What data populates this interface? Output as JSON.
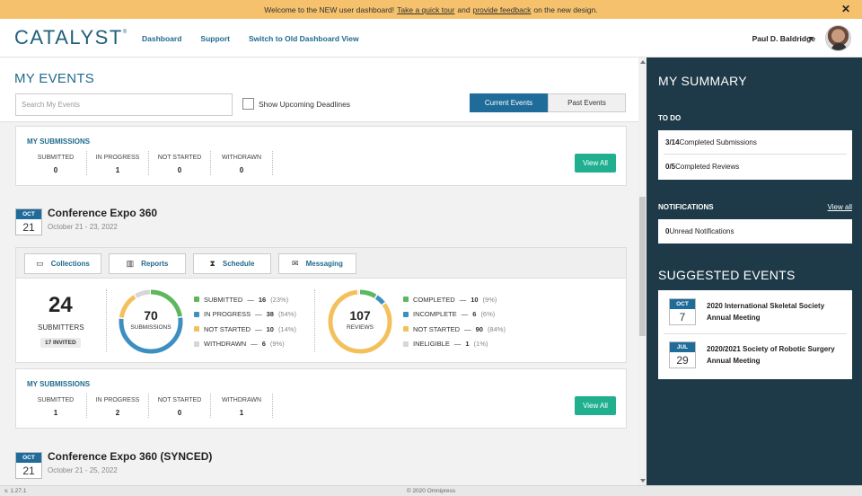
{
  "banner": {
    "text_before": "Welcome to the NEW user dashboard!",
    "link_tour": "Take a quick tour",
    "text_mid": "and",
    "link_feedback": "provide feedback",
    "text_after": "on the new design.",
    "close": "✕"
  },
  "header": {
    "logo": "CATALYST",
    "logo_mark": "®",
    "nav": [
      "Dashboard",
      "Support",
      "Switch to Old Dashboard View"
    ],
    "user_name": "Paul D. Baldridge"
  },
  "main": {
    "title": "MY EVENTS",
    "search_placeholder": "Search My Events",
    "checkbox_label": "Show Upcoming Deadlines",
    "checkbox_checked": false,
    "tabs": [
      "Current Events",
      "Past Events"
    ]
  },
  "top_submissions": {
    "title": "MY SUBMISSIONS",
    "columns": [
      {
        "label": "SUBMITTED",
        "value": "0"
      },
      {
        "label": "IN PROGRESS",
        "value": "1"
      },
      {
        "label": "NOT STARTED",
        "value": "0"
      },
      {
        "label": "WITHDRAWN",
        "value": "0"
      }
    ],
    "view_all": "View All"
  },
  "event1": {
    "month": "OCT",
    "day": "21",
    "name": "Conference Expo 360",
    "dates": "October 21 - 23, 2022",
    "actions": [
      {
        "label": "Collections",
        "icon": "folder-icon",
        "glyph": "▭"
      },
      {
        "label": "Reports",
        "icon": "bar-chart-icon",
        "glyph": "▥"
      },
      {
        "label": "Schedule",
        "icon": "hourglass-icon",
        "glyph": "⧗"
      },
      {
        "label": "Messaging",
        "icon": "envelope-icon",
        "glyph": "✉"
      }
    ],
    "submitters": {
      "count": "24",
      "label": "SUBMITTERS",
      "invited": "17 INVITED"
    },
    "submissions_donut": {
      "total": "70",
      "label": "SUBMISSIONS",
      "segments": [
        {
          "label": "SUBMITTED",
          "count": 16,
          "pct": "(23%)",
          "color": "#5cb85c"
        },
        {
          "label": "IN PROGRESS",
          "count": 38,
          "pct": "(54%)",
          "color": "#3d8fc2"
        },
        {
          "label": "NOT STARTED",
          "count": 10,
          "pct": "(14%)",
          "color": "#f3c05c"
        },
        {
          "label": "WITHDRAWN",
          "count": 6,
          "pct": "(9%)",
          "color": "#d6d6d6"
        }
      ]
    },
    "reviews_donut": {
      "total": "107",
      "label": "REVIEWS",
      "segments": [
        {
          "label": "COMPLETED",
          "count": 10,
          "pct": "(9%)",
          "color": "#5cb85c"
        },
        {
          "label": "INCOMPLETE",
          "count": 6,
          "pct": "(6%)",
          "color": "#3d8fc2"
        },
        {
          "label": "NOT STARTED",
          "count": 90,
          "pct": "(84%)",
          "color": "#f3c05c"
        },
        {
          "label": "INELIGIBLE",
          "count": 1,
          "pct": "(1%)",
          "color": "#d6d6d6"
        }
      ]
    },
    "submissions": {
      "title": "MY SUBMISSIONS",
      "columns": [
        {
          "label": "SUBMITTED",
          "value": "1"
        },
        {
          "label": "IN PROGRESS",
          "value": "2"
        },
        {
          "label": "NOT STARTED",
          "value": "0"
        },
        {
          "label": "WITHDRAWN",
          "value": "1"
        }
      ],
      "view_all": "View All"
    }
  },
  "event2": {
    "month": "OCT",
    "day": "21",
    "name": "Conference Expo 360 (SYNCED)",
    "dates": "October 21 - 25, 2022"
  },
  "sidebar": {
    "title": "MY SUMMARY",
    "todo_title": "TO DO",
    "todo": [
      {
        "strong": "3/14",
        "text": " Completed Submissions"
      },
      {
        "strong": "0/5",
        "text": " Completed Reviews"
      }
    ],
    "notifications_title": "NOTIFICATIONS",
    "notifications_link": "View all",
    "notifications": [
      {
        "strong": "0",
        "text": " Unread Notifications"
      }
    ],
    "suggested_title": "SUGGESTED EVENTS",
    "suggested": [
      {
        "month": "OCT",
        "day": "7",
        "title": "2020 International Skeletal Society Annual Meeting"
      },
      {
        "month": "JUL",
        "day": "29",
        "title": "2020/2021 Society of Robotic Surgery Annual Meeting"
      }
    ]
  },
  "footer": {
    "version": "v. 1.27.1",
    "copyright": "© 2020 Omnipress"
  }
}
